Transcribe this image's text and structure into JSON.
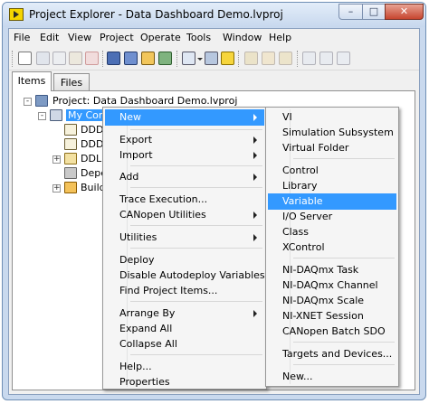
{
  "window": {
    "title": "Project Explorer - Data Dashboard Demo.lvproj",
    "minimize_glyph": "–",
    "maximize_glyph": "□",
    "close_glyph": "✕"
  },
  "menubar": [
    "File",
    "Edit",
    "View",
    "Project",
    "Operate",
    "Tools",
    "Window",
    "Help"
  ],
  "toolbar_icons": [
    "new-icon",
    "cut-icon",
    "copy-icon",
    "paste-icon",
    "delete-icon",
    "save-icon",
    "save-all-icon",
    "build-icon",
    "deploy-icon",
    "view-dropdown-icon",
    "filter-icon",
    "warning-icon",
    "add-file-icon",
    "properties-icon",
    "open-vi-icon",
    "undo-icon",
    "redo-icon",
    "search-icon"
  ],
  "tabs": [
    "Items",
    "Files"
  ],
  "tree": {
    "project": "Project: Data Dashboard Demo.lvproj",
    "target": "My Com",
    "children": [
      "DDDe",
      "DDDe",
      "DDLib",
      "Depe",
      "Build"
    ]
  },
  "context_menu": {
    "groups": [
      [
        {
          "label": "New",
          "submenu": true,
          "highlighted": true
        }
      ],
      [
        {
          "label": "Export",
          "submenu": true
        },
        {
          "label": "Import",
          "submenu": true
        }
      ],
      [
        {
          "label": "Add",
          "submenu": true
        }
      ],
      [
        {
          "label": "Trace Execution..."
        },
        {
          "label": "CANopen Utilities",
          "submenu": true
        }
      ],
      [
        {
          "label": "Utilities",
          "submenu": true
        }
      ],
      [
        {
          "label": "Deploy"
        },
        {
          "label": "Disable Autodeploy Variables"
        },
        {
          "label": "Find Project Items..."
        }
      ],
      [
        {
          "label": "Arrange By",
          "submenu": true
        },
        {
          "label": "Expand All"
        },
        {
          "label": "Collapse All"
        }
      ],
      [
        {
          "label": "Help..."
        },
        {
          "label": "Properties"
        }
      ]
    ]
  },
  "submenu": {
    "groups": [
      [
        {
          "label": "VI"
        },
        {
          "label": "Simulation Subsystem"
        },
        {
          "label": "Virtual Folder"
        }
      ],
      [
        {
          "label": "Control"
        },
        {
          "label": "Library"
        },
        {
          "label": "Variable",
          "highlighted": true
        },
        {
          "label": "I/O Server"
        },
        {
          "label": "Class"
        },
        {
          "label": "XControl"
        }
      ],
      [
        {
          "label": "NI-DAQmx Task"
        },
        {
          "label": "NI-DAQmx Channel"
        },
        {
          "label": "NI-DAQmx Scale"
        },
        {
          "label": "NI-XNET Session"
        },
        {
          "label": "CANopen Batch SDO"
        }
      ],
      [
        {
          "label": "Targets and Devices..."
        }
      ],
      [
        {
          "label": "New..."
        }
      ]
    ]
  }
}
